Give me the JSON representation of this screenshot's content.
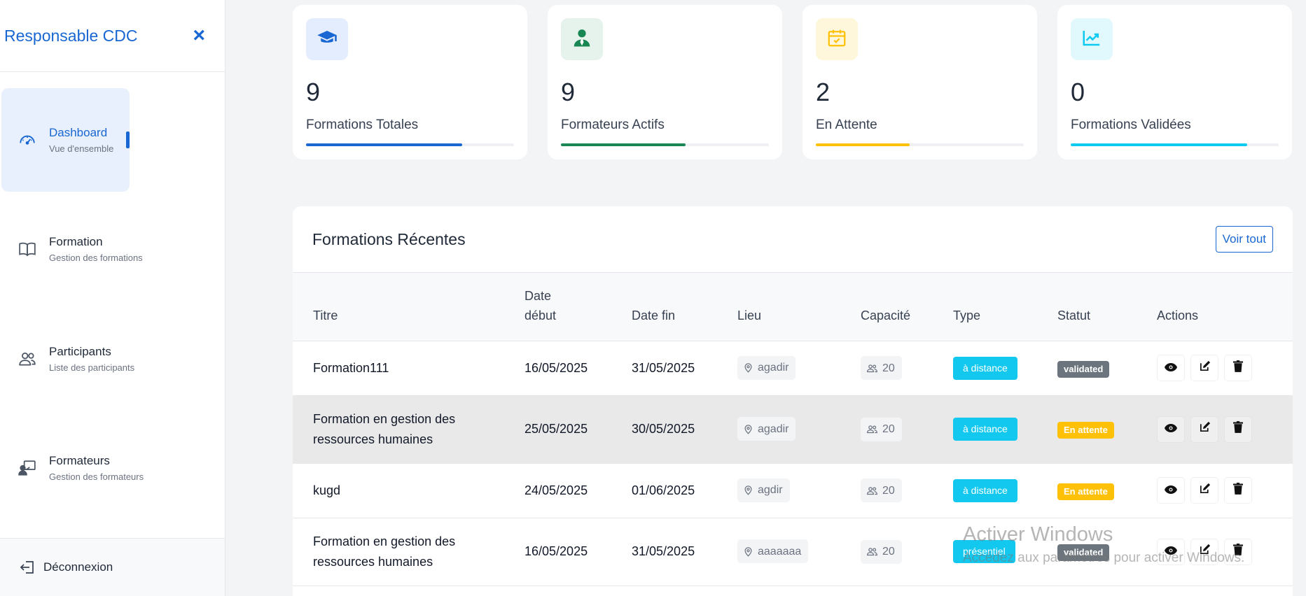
{
  "sidebar": {
    "title": "Responsable CDC",
    "close_label": "×",
    "items": [
      {
        "label": "Dashboard",
        "sub": "Vue d'ensemble",
        "icon": "speedometer-icon"
      },
      {
        "label": "Formation",
        "sub": "Gestion des formations",
        "icon": "book-icon"
      },
      {
        "label": "Participants",
        "sub": "Liste des participants",
        "icon": "people-icon"
      },
      {
        "label": "Formateurs",
        "sub": "Gestion des formateurs",
        "icon": "teacher-icon"
      }
    ],
    "logout_label": "Déconnexion"
  },
  "stats": [
    {
      "value": "9",
      "label": "Formations Totales",
      "icon": "graduation-cap-icon",
      "color": "#1967d2",
      "bg": "#e3edfd",
      "progress": 0.75
    },
    {
      "value": "9",
      "label": "Formateurs Actifs",
      "icon": "user-tie-icon",
      "color": "#198754",
      "bg": "#e6f3ec",
      "progress": 0.6
    },
    {
      "value": "2",
      "label": "En Attente",
      "icon": "calendar-check-icon",
      "color": "#ffc107",
      "bg": "#fff7dc",
      "progress": 0.45
    },
    {
      "value": "0",
      "label": "Formations Validées",
      "icon": "chart-line-icon",
      "color": "#0dcaf0",
      "bg": "#e1f9fd",
      "progress": 0.85
    }
  ],
  "recent": {
    "title": "Formations Récentes",
    "view_all": "Voir tout",
    "columns": {
      "titre": "Titre",
      "date_debut_1": "Date",
      "date_debut_2": "début",
      "date_fin": "Date fin",
      "lieu": "Lieu",
      "capacite": "Capacité",
      "type": "Type",
      "statut": "Statut",
      "actions": "Actions"
    },
    "rows": [
      {
        "titre_1": "Formation111",
        "titre_2": "",
        "debut": "16/05/2025",
        "fin": "31/05/2025",
        "lieu": "agadir",
        "capacite": "20",
        "type": "à distance",
        "statut": "validated"
      },
      {
        "titre_1": "Formation en gestion des",
        "titre_2": "ressources humaines",
        "debut": "25/05/2025",
        "fin": "30/05/2025",
        "lieu": "agadir",
        "capacite": "20",
        "type": "à distance",
        "statut": "En attente"
      },
      {
        "titre_1": "kugd",
        "titre_2": "",
        "debut": "24/05/2025",
        "fin": "01/06/2025",
        "lieu": "agdir",
        "capacite": "20",
        "type": "à distance",
        "statut": "En attente"
      },
      {
        "titre_1": "Formation en gestion des",
        "titre_2": "ressources humaines",
        "debut": "16/05/2025",
        "fin": "31/05/2025",
        "lieu": "aaaaaaa",
        "capacite": "20",
        "type": "présentiel",
        "statut": "validated"
      }
    ]
  },
  "watermark": {
    "line1": "Activer Windows",
    "line2": "Accédez aux paramètres pour activer Windows."
  }
}
